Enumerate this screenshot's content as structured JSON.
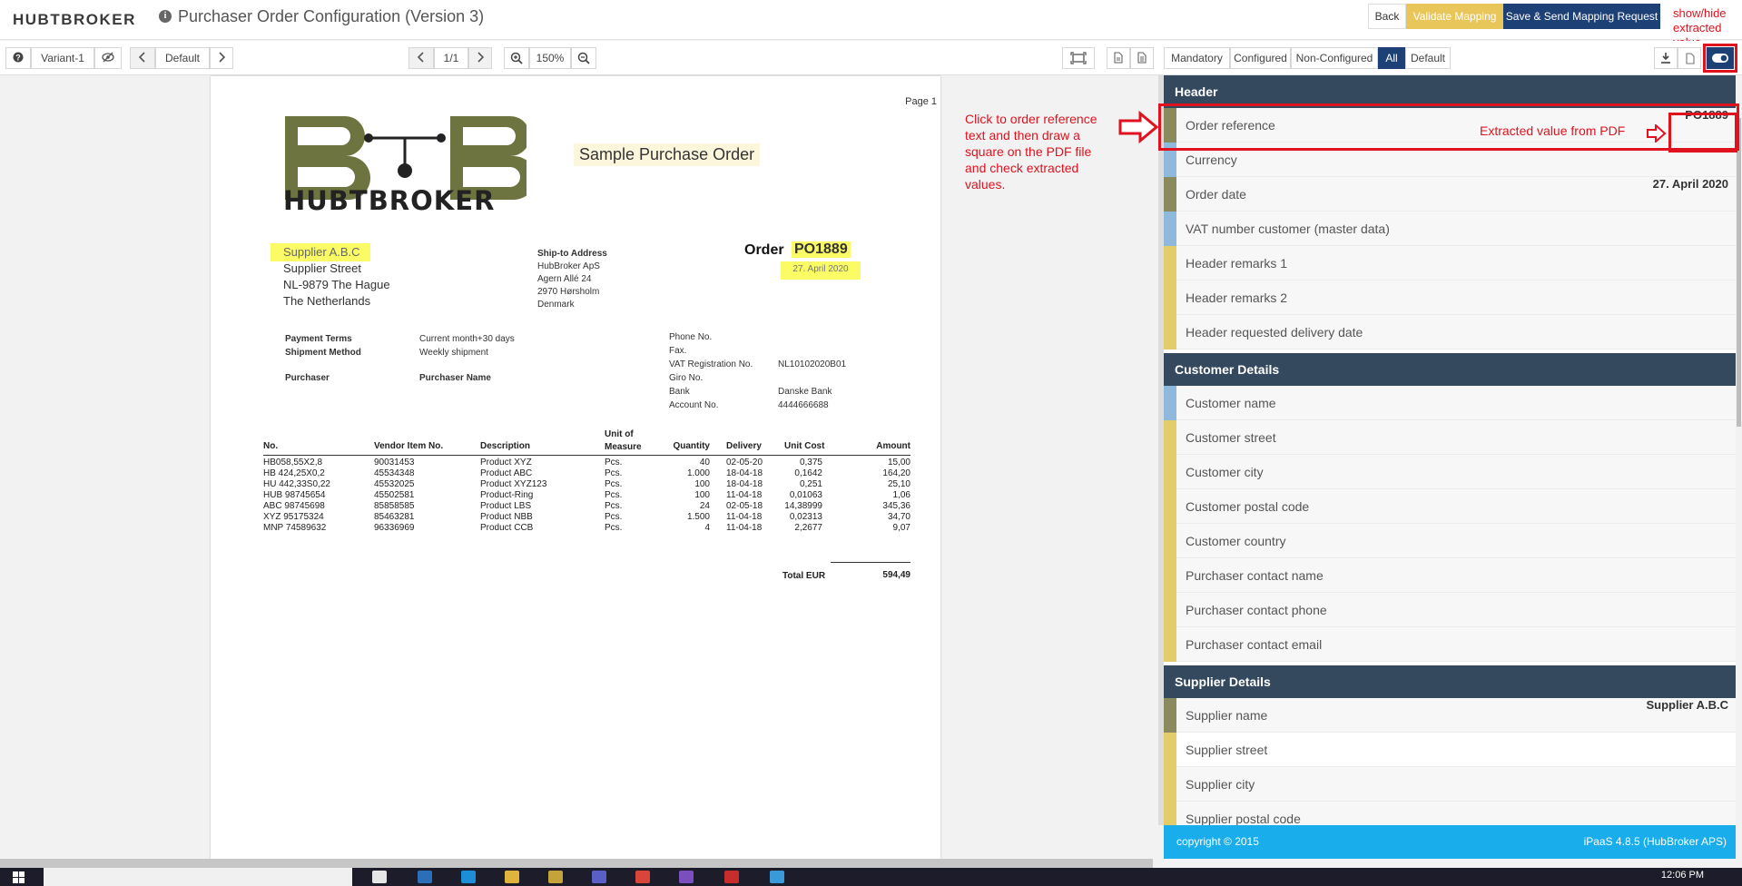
{
  "app": {
    "logo": "HUBTBROKER",
    "title": "Purchaser Order Configuration (Version 3)",
    "buttons": {
      "back": "Back",
      "validate": "Validate Mapping",
      "save": "Save & Send Mapping Request"
    }
  },
  "toolbar": {
    "variant": "Variant-1",
    "layout": "Default",
    "page": "1/1",
    "zoom": "150%",
    "filters": [
      "Mandatory",
      "Configured",
      "Non-Configured",
      "All",
      "Default"
    ],
    "active_filter": "All"
  },
  "annotations": {
    "show_hide": "show/hide extracted value",
    "click_instruction": "Click to order reference text and then draw a square on the PDF file and check extracted values.",
    "extracted_value": "Extracted value from PDF"
  },
  "pdf": {
    "page_label": "Page 1",
    "logo_text": "HUBTBROKER",
    "sample_title": "Sample Purchase Order",
    "supplier": {
      "name": "Supplier A.B.C",
      "street": "Supplier Street",
      "city": "NL-9879 The Hague",
      "country": "The Netherlands"
    },
    "ship_to": {
      "label": "Ship-to Address",
      "lines": [
        "HubBroker ApS",
        "Agern Allé 24",
        "2970 Hørsholm",
        "Denmark"
      ]
    },
    "order": {
      "label": "Order",
      "number": "PO1889",
      "date": "27. April 2020"
    },
    "terms": {
      "payment_label": "Payment Terms",
      "payment_value": "Current month+30 days",
      "shipment_label": "Shipment Method",
      "shipment_value": "Weekly shipment",
      "purchaser_label": "Purchaser",
      "purchaser_value": "Purchaser Name"
    },
    "contact": {
      "labels": [
        "Phone No.",
        "Fax.",
        "VAT Registration No.",
        "Giro No.",
        "Bank",
        "Account No."
      ],
      "values": [
        "",
        "",
        "NL10102020B01",
        "",
        "Danske Bank",
        "4444666688"
      ]
    },
    "table": {
      "headers": [
        "No.",
        "Vendor Item No.",
        "Description",
        "Unit of Measure",
        "Quantity",
        "Delivery",
        "Unit Cost",
        "Amount"
      ],
      "rows": [
        [
          "HB058,55X2,8",
          "90031453",
          "Product XYZ",
          "Pcs.",
          "40",
          "02-05-20",
          "0,375",
          "15,00"
        ],
        [
          "HB 424,25X0,2",
          "45534348",
          "Product ABC",
          "Pcs.",
          "1.000",
          "18-04-18",
          "0,1642",
          "164,20"
        ],
        [
          "HU 442,33S0,22",
          "45532025",
          "Product XYZ123",
          "Pcs.",
          "100",
          "18-04-18",
          "0,251",
          "25,10"
        ],
        [
          "HUB 98745654",
          "45502581",
          "Product-Ring",
          "Pcs.",
          "100",
          "11-04-18",
          "0,01063",
          "1,06"
        ],
        [
          "ABC 98745698",
          "85858585",
          "Product LBS",
          "Pcs.",
          "24",
          "02-05-18",
          "14,38999",
          "345,36"
        ],
        [
          "XYZ 95175324",
          "85463281",
          "Product NBB",
          "Pcs.",
          "1.500",
          "11-04-18",
          "0,02313",
          "34,70"
        ],
        [
          "MNP 74589632",
          "96336969",
          "Product CCB",
          "Pcs.",
          "4",
          "11-04-18",
          "2,2677",
          "9,07"
        ]
      ],
      "total_label": "Total EUR",
      "total_value": "594,49"
    }
  },
  "panel": {
    "sections": [
      {
        "title": "Header"
      },
      {
        "title": "Customer Details"
      },
      {
        "title": "Supplier Details"
      }
    ],
    "fields": [
      {
        "label": "Order reference",
        "value": "PO1889",
        "color": "#8a8a5c"
      },
      {
        "label": "Currency",
        "value": "",
        "color": "#8fb9dc"
      },
      {
        "label": "Order date",
        "value": "27. April 2020",
        "color": "#8a8a5c"
      },
      {
        "label": "VAT number customer (master data)",
        "value": "",
        "color": "#8fb9dc"
      },
      {
        "label": "Header remarks 1",
        "value": "",
        "color": "#e3cc6a"
      },
      {
        "label": "Header remarks 2",
        "value": "",
        "color": "#e3cc6a"
      },
      {
        "label": "Header requested delivery date",
        "value": "",
        "color": "#e3cc6a"
      },
      {
        "label": "Customer name",
        "value": "",
        "color": "#8fb9dc"
      },
      {
        "label": "Customer street",
        "value": "",
        "color": "#e3cc6a"
      },
      {
        "label": "Customer city",
        "value": "",
        "color": "#e3cc6a"
      },
      {
        "label": "Customer postal code",
        "value": "",
        "color": "#e3cc6a"
      },
      {
        "label": "Customer country",
        "value": "",
        "color": "#e3cc6a"
      },
      {
        "label": "Purchaser contact name",
        "value": "",
        "color": "#e3cc6a"
      },
      {
        "label": "Purchaser contact phone",
        "value": "",
        "color": "#e3cc6a"
      },
      {
        "label": "Purchaser contact email",
        "value": "",
        "color": "#e3cc6a"
      },
      {
        "label": "Supplier name",
        "value": "Supplier A.B.C",
        "color": "#8a8a5c"
      },
      {
        "label": "Supplier street",
        "value": "",
        "color": "#e3cc6a"
      },
      {
        "label": "Supplier city",
        "value": "",
        "color": "#e3cc6a"
      },
      {
        "label": "Supplier postal code",
        "value": "",
        "color": "#e3cc6a"
      }
    ]
  },
  "footer": {
    "copyright": "copyright © 2015",
    "version": "iPaaS 4.8.5 (HubBroker APS)"
  },
  "taskbar": {
    "time": "12:06 PM"
  }
}
